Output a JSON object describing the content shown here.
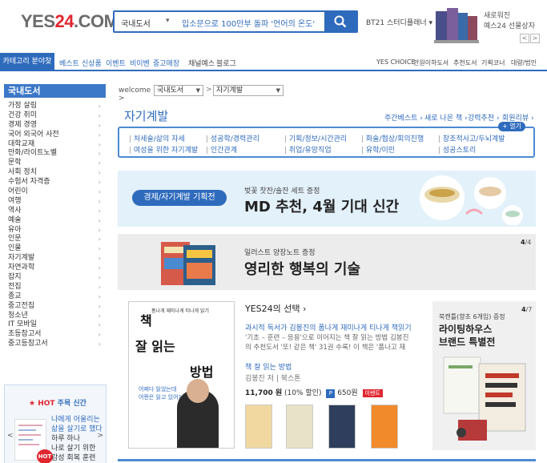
{
  "header": {
    "logo_main": "YES",
    "logo_num": "24",
    "logo_suffix": ".COM",
    "search_scope": "국내도서",
    "search_value": "입소문으로 100만부 돌파 '언어의 온도'",
    "promo_link": "BT21 스터디플래너 ▾",
    "gift_line1": "새로워진",
    "gift_line2": "예스24 선물상자",
    "gift_prev": "<",
    "gift_next": ">"
  },
  "nav": {
    "category_button": "카테고리 분야찾기",
    "items": [
      "베스트",
      "신상품",
      "이벤트",
      "비이벤",
      "중고매장",
      "채널예스",
      "블로그"
    ],
    "right_items": [
      "YES CHOICE",
      "만원이하도서",
      "추천도서",
      "기획코너",
      "대량/법인"
    ]
  },
  "sidebar": {
    "title": "국내도서",
    "items": [
      "가정 살림",
      "건강 취미",
      "경제 경영",
      "국어 외국어 사전",
      "대학교재",
      "만화/라이트노벨",
      "문학",
      "사회 정치",
      "수험서 자격증",
      "어린이",
      "여행",
      "역사",
      "예술",
      "유아",
      "인문",
      "인물",
      "자기계발",
      "자연과학",
      "잡지",
      "전집",
      "종교",
      "중고전집",
      "청소년",
      "IT 모바일",
      "초등참고서",
      "중고등참고서"
    ],
    "hot": {
      "title_star": "★ HOT",
      "title_rest": " 주목 신간",
      "line1": "나에게 어울리는",
      "line2": "삶을 살기로 했다",
      "line3": "하루 하나",
      "line4": "나로 살기 위한",
      "line5": "감성 회복 훈련",
      "badge": "HOT",
      "prev": "<",
      "next": ">"
    }
  },
  "breadcrumb": {
    "home": "welcome >",
    "level1": "국내도서",
    "level2": "자기계발",
    "sep": ">"
  },
  "category": {
    "title": "자기계발",
    "links": [
      "주간베스트 ›",
      "새로 나온 책 ›",
      "강력추천 ›",
      "회원리뷰 ›"
    ],
    "more": "+ 열기",
    "subcategories": [
      "처세술/삶의 자세",
      "성공학/경력관리",
      "기획/정보/시간관리",
      "화술/협상/회의진행",
      "창조적사고/두뇌계발",
      "여성을 위한 자기계발",
      "인간관계",
      "취업/유망직업",
      "유학/이민",
      "성공스토리"
    ]
  },
  "banner1": {
    "pill": "경제/자기계발 기획전",
    "small": "벚꽃 찻잔/솔잔 세트 증정",
    "big": "MD 추천, 4월 기대 신간"
  },
  "banner2": {
    "small": "일러스트 양장노트 증정",
    "big": "영리한 행복의 기술",
    "page_cur": "4",
    "page_total": "/4"
  },
  "featured": {
    "head_prefix": "YES24의 선택",
    "head_arrow": " ›",
    "title": "과시적 독서가 김봉진의 폼나게 재미나게 티나게 책읽기",
    "desc1": "'기초 – 훈련 – 응용'으로 이어지는 책 잘 읽는 방법 김봉진",
    "desc2": "의 추천도서 '또! 같은 책' 31권 수록! 이 책은 '폼나고 재",
    "book": "책 잘 읽는 방법",
    "author": "김봉진 저 | 북스톤",
    "price": "11,700 원",
    "discount": " (10% 할인) ",
    "point_icon": "P",
    "points": " 650원 ",
    "event": "이벤트",
    "cover_top": "폼나게 재미나게 티나게 읽기",
    "cover_1": "책",
    "cover_2": "잘 읽는",
    "cover_3": "방법",
    "cover_q1": "어쩌다 읽었는데",
    "cover_q2": "어쩐은 읽고 있어?"
  },
  "promo": {
    "small": "북캔틀(향초 6개입) 증정",
    "big1": "라이팅하우스",
    "big2": "브랜드 특별전",
    "page_cur": "4",
    "page_total": "/7"
  },
  "colors": {
    "brand_blue": "#2f6bbd",
    "brand_red": "#e0262f"
  }
}
